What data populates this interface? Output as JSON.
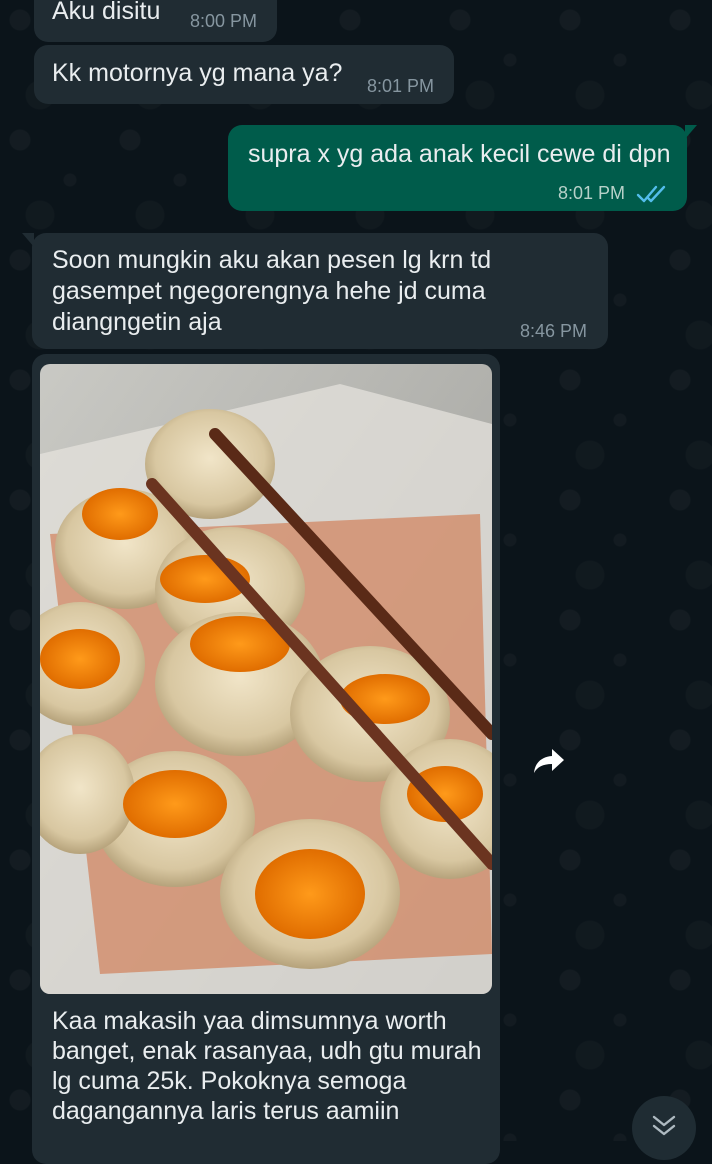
{
  "messages": [
    {
      "id": "m1",
      "direction": "incoming",
      "text": "Aku disitu",
      "time": "8:00 PM"
    },
    {
      "id": "m2",
      "direction": "incoming",
      "text": "Kk motornya yg mana ya?",
      "time": "8:01 PM"
    },
    {
      "id": "m3",
      "direction": "outgoing",
      "text": "supra x yg ada anak kecil cewe di dpn",
      "time": "8:01 PM",
      "status": "read"
    },
    {
      "id": "m4",
      "direction": "incoming",
      "text": "Soon mungkin aku akan pesen lg krn td\ngasempet ngegorengnya hehe jd cuma\ndiangngetin aja",
      "time": "8:46 PM"
    },
    {
      "id": "m5",
      "direction": "incoming",
      "type": "image",
      "image_subject": "dimsum-in-plastic-container-with-chopsticks",
      "caption": "Kaa makasih yaa dimsumnya worth\nbanget, enak rasanyaa, udh gtu murah\nlg cuma 25k. Pokoknya semoga\ndagangannya laris terus aamiin"
    }
  ],
  "icons": {
    "read_receipt": "double-check-icon",
    "forward": "forward-arrow-icon",
    "scroll_down": "double-chevron-down-icon"
  },
  "colors": {
    "background": "#0b141a",
    "incoming_bubble": "#202c33",
    "outgoing_bubble": "#005c4b",
    "read_tick": "#53bdeb",
    "timestamp": "#8696a0"
  }
}
